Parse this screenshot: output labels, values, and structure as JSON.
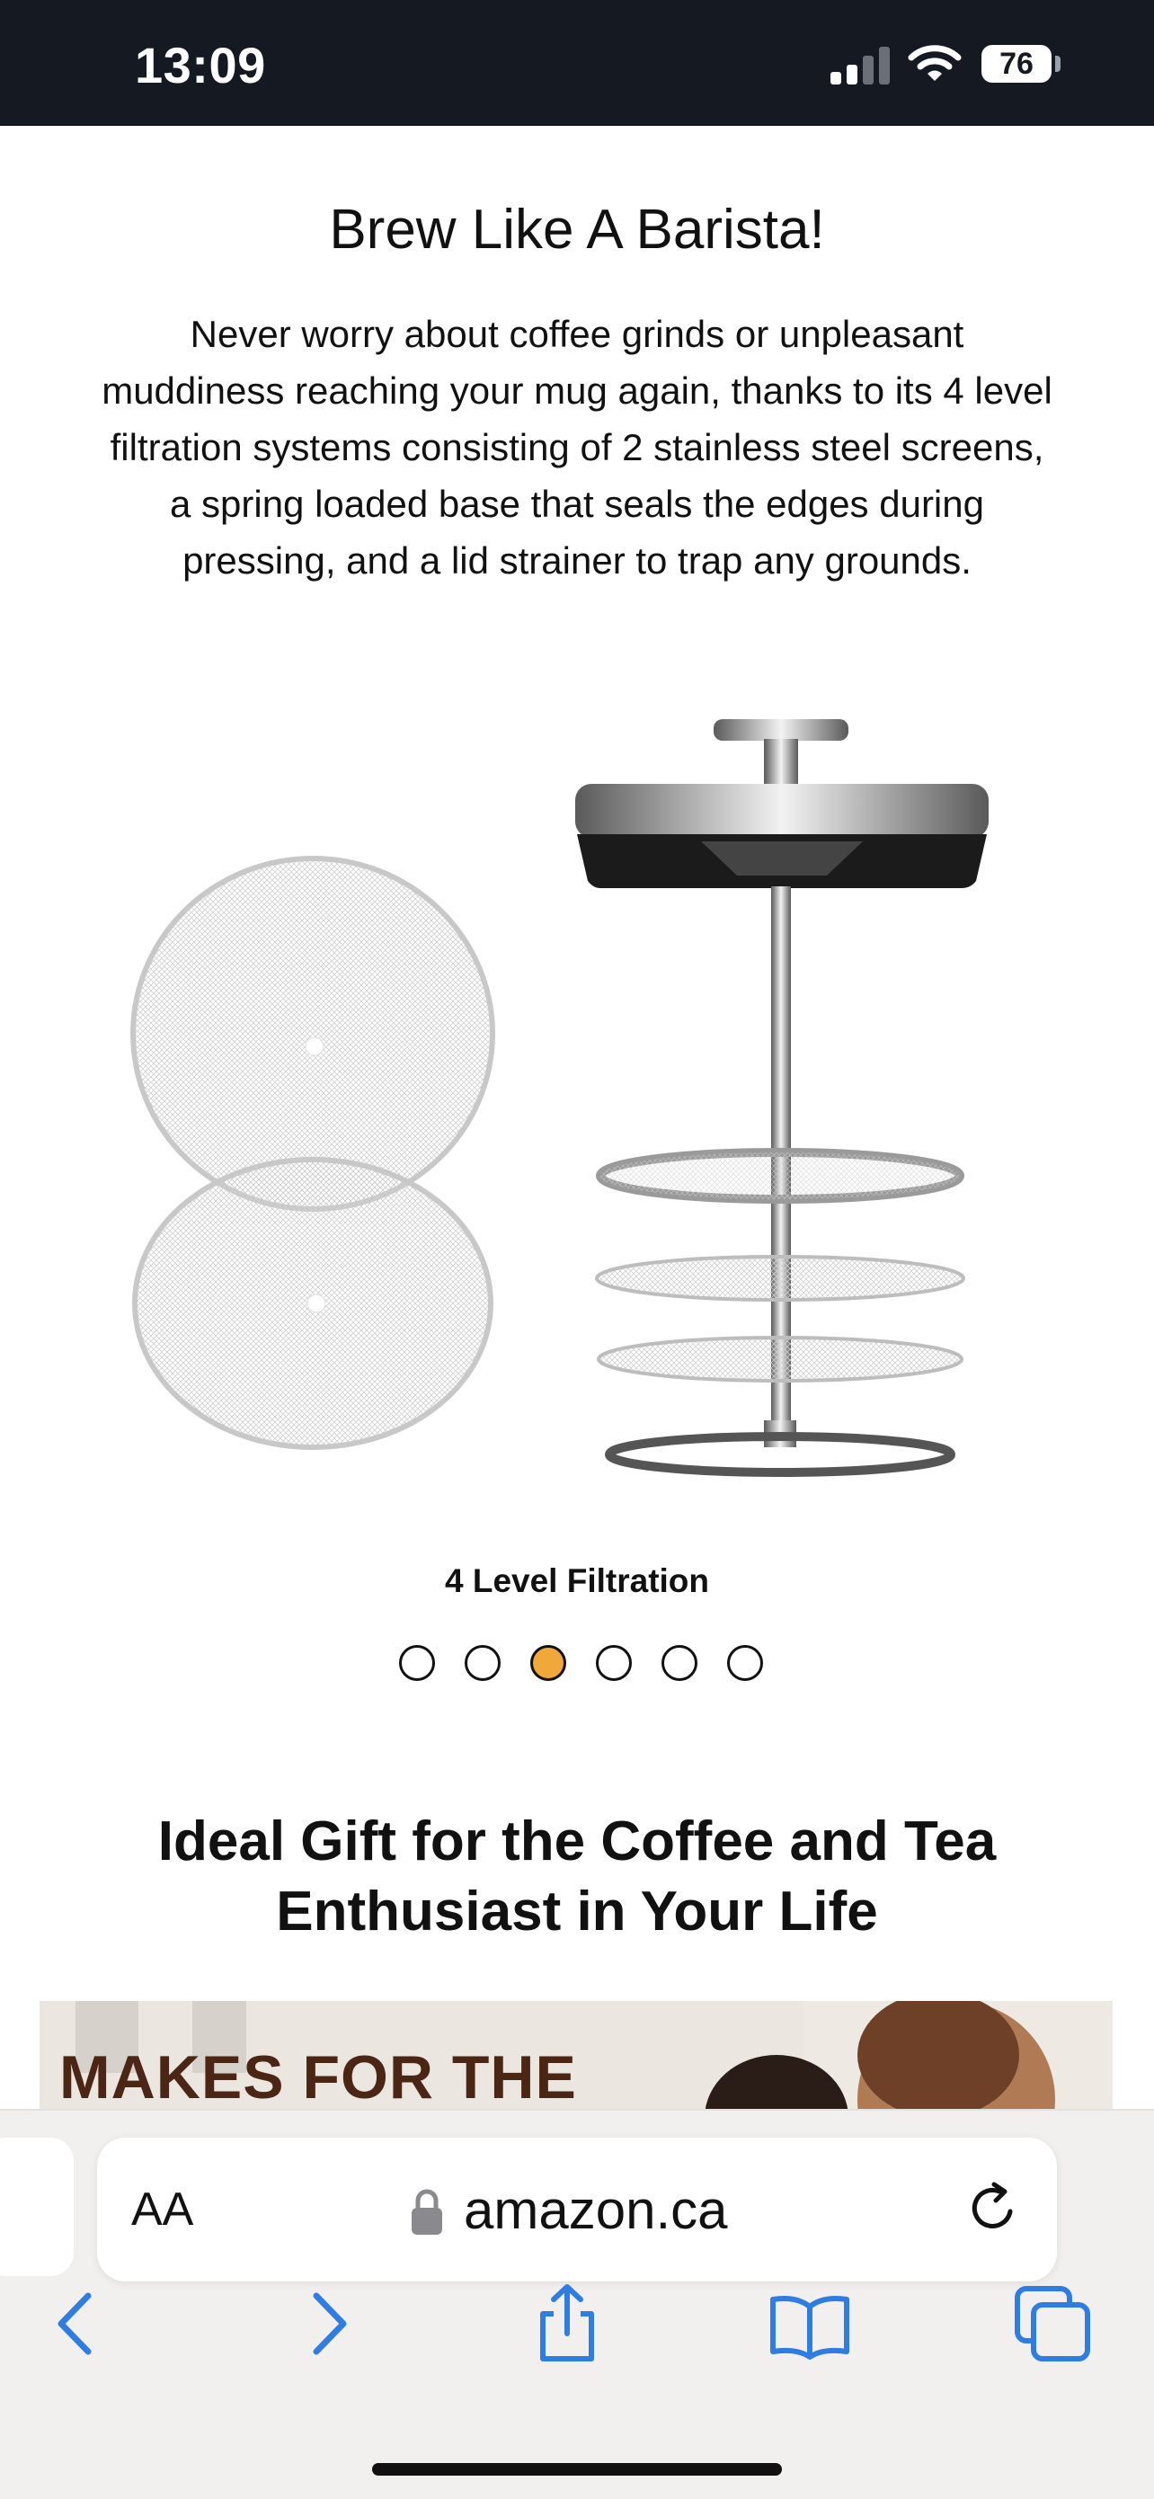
{
  "status_bar": {
    "time": "13:09",
    "battery": "76"
  },
  "content": {
    "headline": "Brew Like A Barista!",
    "description": "Never worry about coffee grinds or unpleasant muddiness reaching your mug again, thanks to its 4 level filtration systems consisting of 2 stainless steel screens, a spring loaded base that seals the edges during pressing, and a lid strainer to trap any grounds.",
    "carousel": {
      "caption": "4 Level Filtration",
      "dot_count": 6,
      "active_index": 2,
      "active_color": "#f0a83a"
    },
    "gift_title": "Ideal Gift for the Coffee and Tea Enthusiast in Your Life",
    "banner_text": "MAKES FOR THE"
  },
  "browser": {
    "text_size_button": "AA",
    "url": "amazon.ca",
    "toolbar": [
      "back-icon",
      "forward-icon",
      "share-icon",
      "bookmarks-icon",
      "tabs-icon"
    ],
    "accent_color": "#2f7de1"
  }
}
